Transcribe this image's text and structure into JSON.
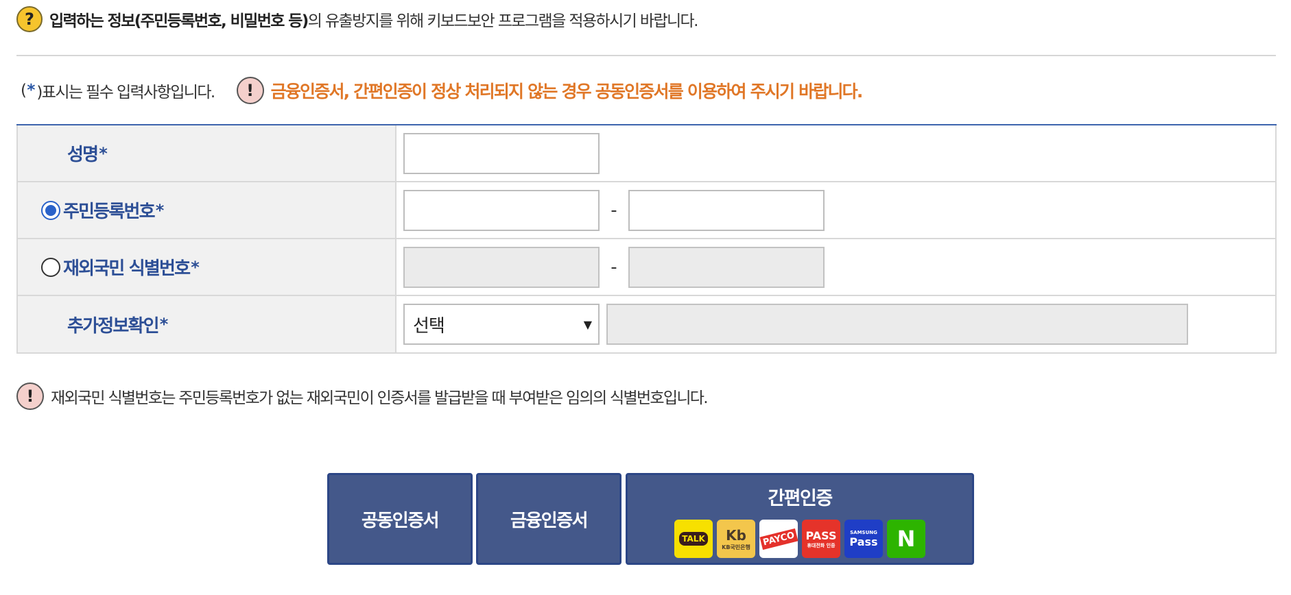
{
  "top_notice": {
    "icon": "question-circle-icon",
    "bold_text": "입력하는 정보(주민등록번호, 비밀번호 등)",
    "text": "의 유출방지를 위해 키보드보안 프로그램을 적용하시기 바랍니다."
  },
  "required_line": {
    "open": "(",
    "star": "*",
    "close": ")표시는 필수 입력사항입니다.",
    "warn_icon": "exclamation-circle-icon",
    "warn_text": "금융인증서, 간편인증이 정상 처리되지 않는 경우 공동인증서를 이용하여 주시기 바랍니다."
  },
  "form": {
    "name_label": "성명",
    "resident_label": "주민등록번호",
    "foreign_label": "재외국민 식별번호",
    "extra_label": "추가정보확인",
    "star": "*",
    "dash": "-",
    "select_value": "선택",
    "selected_id_type": "resident"
  },
  "bottom_notice": {
    "icon": "exclamation-circle-icon",
    "text": "재외국민 식별번호는 주민등록번호가 없는 재외국민이 인증서를 발급받을 때 부여받은 임의의 식별번호입니다."
  },
  "buttons": {
    "joint_cert": "공동인증서",
    "financial_cert": "금융인증서",
    "simple_auth": "간편인증"
  },
  "apps": {
    "kakao": "TALK",
    "kb_mark": "Kb",
    "kb_sub": "KB국민은행",
    "payco": "PAYCO",
    "pass": "PASS",
    "pass_sub": "휴대전화 인증",
    "samsung_top": "SAMSUNG",
    "samsung_pass": "Pass",
    "naver": "N"
  },
  "colors": {
    "accent_blue": "#2d4f96",
    "warning_orange": "#e07727",
    "button_bg": "#44588a"
  }
}
